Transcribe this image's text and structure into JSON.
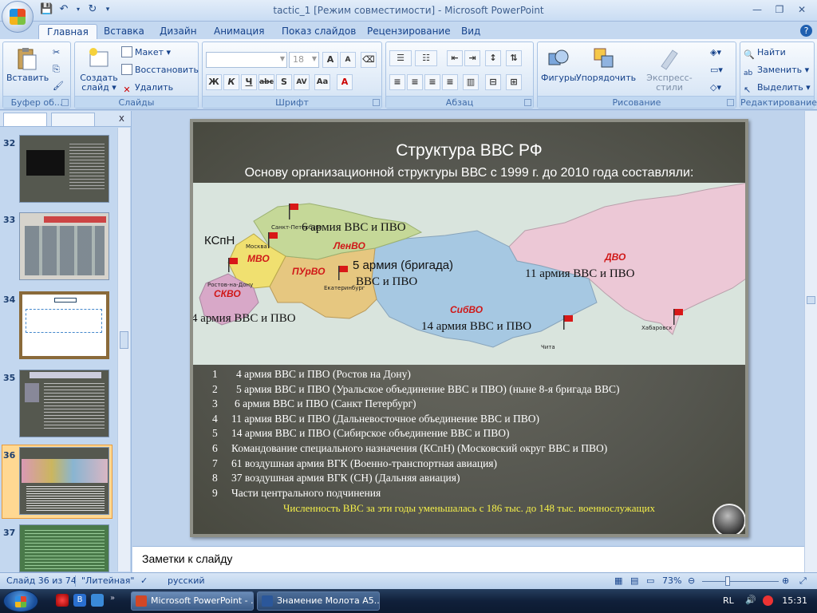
{
  "window": {
    "title": "tactic_1 [Режим совместимости] - Microsoft PowerPoint"
  },
  "tabs": [
    "Главная",
    "Вставка",
    "Дизайн",
    "Анимация",
    "Показ слайдов",
    "Рецензирование",
    "Вид"
  ],
  "ribbon": {
    "clipboard": {
      "title": "Буфер об...",
      "paste": "Вставить"
    },
    "slides": {
      "title": "Слайды",
      "new_slide_1": "Создать",
      "new_slide_2": "слайд",
      "layout": "Макет",
      "reset": "Восстановить",
      "delete": "Удалить"
    },
    "font": {
      "title": "Шрифт",
      "font_name": "",
      "font_size": "18"
    },
    "paragraph": {
      "title": "Абзац"
    },
    "drawing": {
      "title": "Рисование",
      "shapes": "Фигуры",
      "arrange": "Упорядочить",
      "quick_styles": "Экспресс-стили"
    },
    "editing": {
      "title": "Редактирование",
      "find": "Найти",
      "replace": "Заменить",
      "select": "Выделить"
    }
  },
  "slides_panel": {
    "thumbnails": [
      {
        "num": "32"
      },
      {
        "num": "33"
      },
      {
        "num": "34"
      },
      {
        "num": "35"
      },
      {
        "num": "36"
      },
      {
        "num": "37"
      }
    ]
  },
  "slide": {
    "title": "Структура ВВС РФ",
    "subtitle": "Основу организационной структуры ВВС с 1999 г. до 2010 года составляли:",
    "map_labels": {
      "kspn": "КСпН",
      "army6": "6 армия ВВС и ПВО",
      "army5_line1": "5 армия (бригада)",
      "army5_line2": "ВВС и ПВО",
      "army11": "11 армия ВВС и ПВО",
      "army4": "4 армия ВВС и ПВО",
      "army14": "14 армия ВВС и ПВО"
    },
    "regions": {
      "mvo": "МВО",
      "lenvo": "ЛенВО",
      "purvo": "ПУрВО",
      "skvo": "СКВО",
      "sibvo": "СибВО",
      "dvo": "ДВО"
    },
    "cities": {
      "spb": "Санкт-Петербург",
      "moscow": "Москва",
      "rostov": "Ростов-на-Дону",
      "ekb": "Екатеринбург",
      "chita": "Чита",
      "khabarovsk": "Хабаровск"
    },
    "list": [
      {
        "num": "1",
        "text": "4 армия ВВС и ПВО   (Ростов на Дону)"
      },
      {
        "num": "2",
        "text": "5 армия ВВС и ПВО (Уральское объединение ВВС и ПВО) (ныне 8-я бригада ВВС)"
      },
      {
        "num": "3",
        "text": "6 армия ВВС и ПВО (Санкт Петербург)"
      },
      {
        "num": "4",
        "text": "11 армия ВВС и ПВО (Дальневосточное объединение ВВС и ПВО)"
      },
      {
        "num": "5",
        "text": "14 армия ВВС и ПВО (Сибирское объединение ВВС и ПВО)"
      },
      {
        "num": "6",
        "text": "Командование специального назначения (КСпН)     (Московский округ ВВС и ПВО)"
      },
      {
        "num": "7",
        "text": "61 воздушная армия ВГК (Военно-транспортная авиация)"
      },
      {
        "num": "8",
        "text": "37 воздушная армия ВГК (СН) (Дальняя авиация)"
      },
      {
        "num": "9",
        "text": "Части центрального подчинения"
      }
    ],
    "note": "Численность ВВС за эти годы уменьшалась с 186 тыс.  до 148 тыс. военнослужащих"
  },
  "notes": {
    "placeholder": "Заметки к слайду"
  },
  "status": {
    "slide_info": "Слайд 36 из 74",
    "theme": "\"Литейная\"",
    "language": "русский",
    "zoom": "73%"
  },
  "taskbar": {
    "tasks": [
      "Microsoft PowerPoint - ...",
      "Знамение Молота А5..."
    ],
    "lang": "RL",
    "time": "15:31"
  },
  "colors": {
    "note_yellow": "#f5f04a",
    "selection_orange": "#f0a848",
    "region_red": "#d01818"
  }
}
